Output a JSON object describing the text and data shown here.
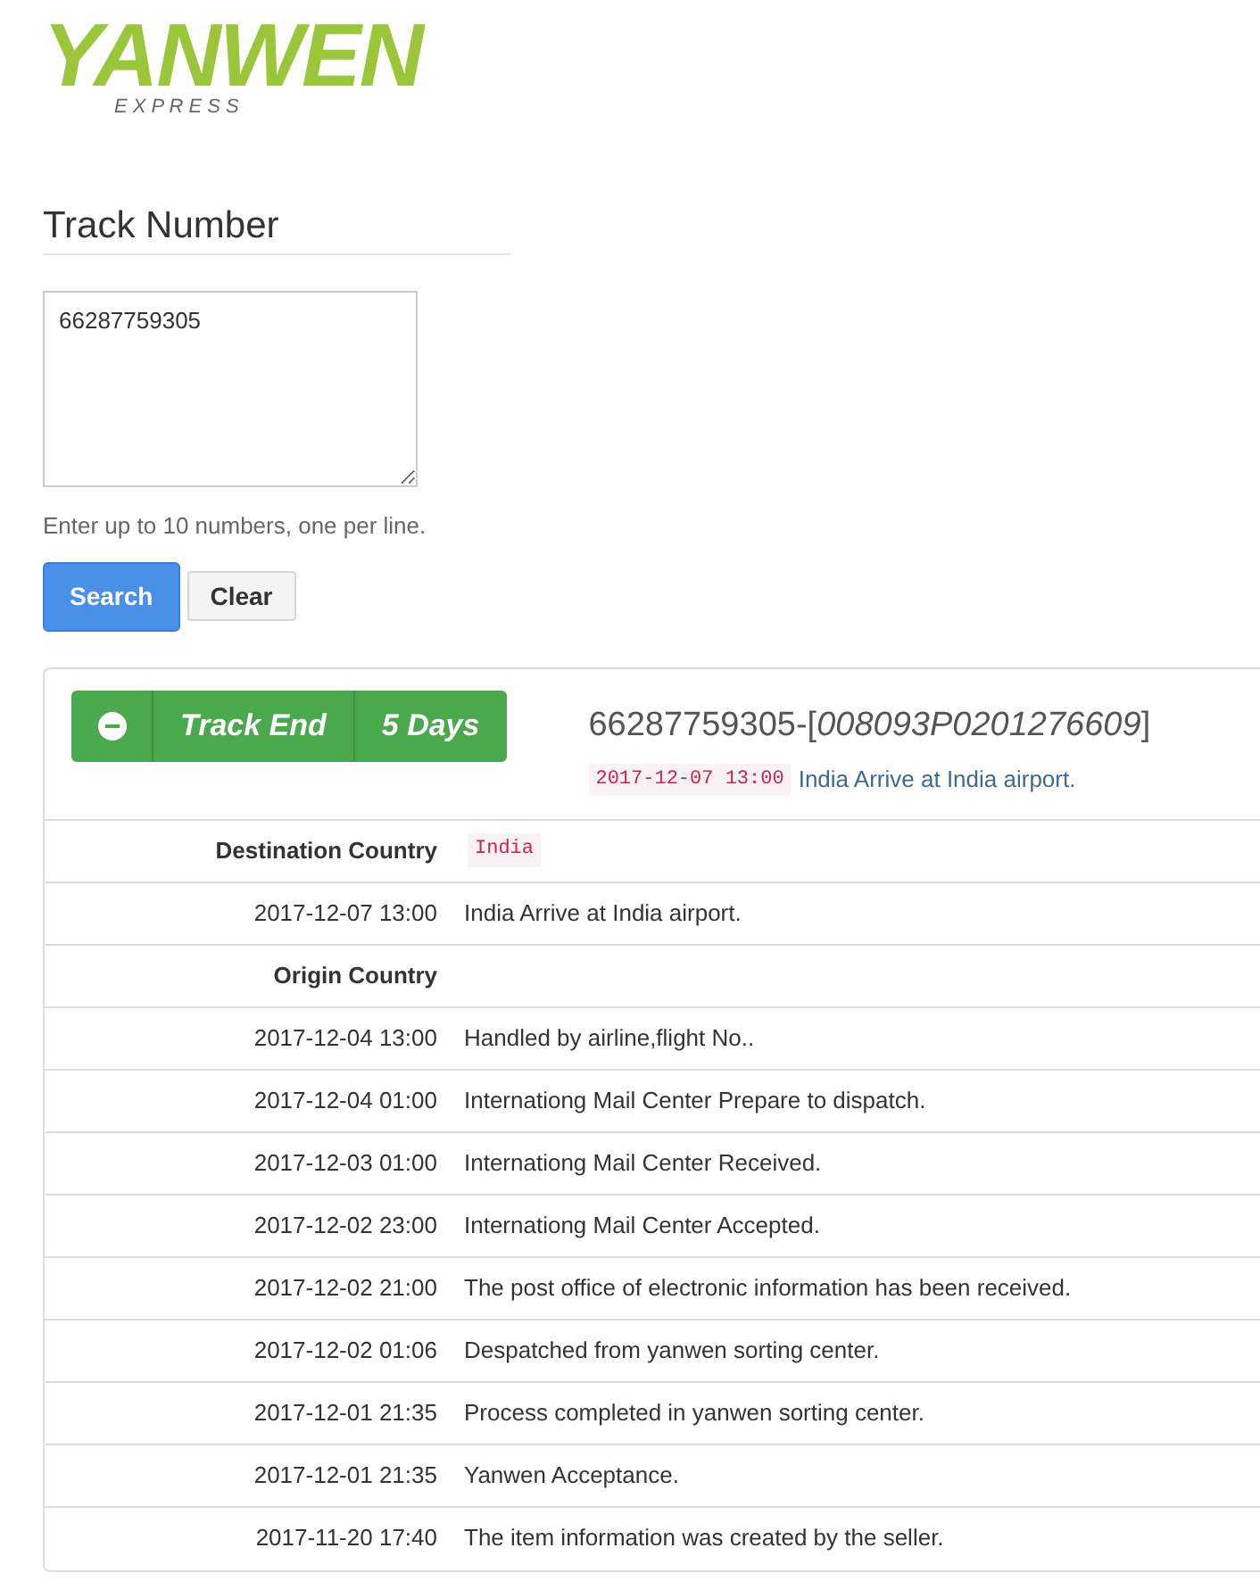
{
  "logo": {
    "word": "YANWEN",
    "tagline": "E X P R E S S"
  },
  "form": {
    "title": "Track Number",
    "value": "66287759305",
    "help": "Enter up to 10 numbers, one per line.",
    "buttons": [
      {
        "label": "Search",
        "kind": "primary"
      },
      {
        "label": "Clear",
        "kind": "default"
      }
    ]
  },
  "result": {
    "status": "Track End",
    "duration": "5 Days",
    "number": "66287759305-[",
    "ref": "008093P0201276609",
    "close": "]",
    "latest_time": "2017-12-07 13:00",
    "latest_event": "India Arrive at India airport.",
    "rows": [
      {
        "kind": "header",
        "label": "Destination Country",
        "value": "India"
      },
      {
        "kind": "event",
        "label": "2017-12-07 13:00",
        "value": "India Arrive at India airport."
      },
      {
        "kind": "header",
        "label": "Origin Country"
      },
      {
        "kind": "event",
        "label": "2017-12-04 13:00",
        "value": "Handled by airline,flight No.."
      },
      {
        "kind": "event",
        "label": "2017-12-04 01:00",
        "value": "Internationg Mail Center Prepare to dispatch."
      },
      {
        "kind": "event",
        "label": "2017-12-03 01:00",
        "value": "Internationg Mail Center Received."
      },
      {
        "kind": "event",
        "label": "2017-12-02 23:00",
        "value": "Internationg Mail Center Accepted."
      },
      {
        "kind": "event",
        "label": "2017-12-02 21:00",
        "value": "The post office of electronic information has been received."
      },
      {
        "kind": "event",
        "label": "2017-12-02 01:06",
        "value": "Despatched from yanwen sorting center."
      },
      {
        "kind": "event",
        "label": "2017-12-01 21:35",
        "value": "Process completed in yanwen sorting center."
      },
      {
        "kind": "event",
        "label": "2017-12-01 21:35",
        "value": "Yanwen Acceptance."
      },
      {
        "kind": "event",
        "label": "2017-11-20 17:40",
        "value": "The item information was created by the seller."
      }
    ]
  }
}
